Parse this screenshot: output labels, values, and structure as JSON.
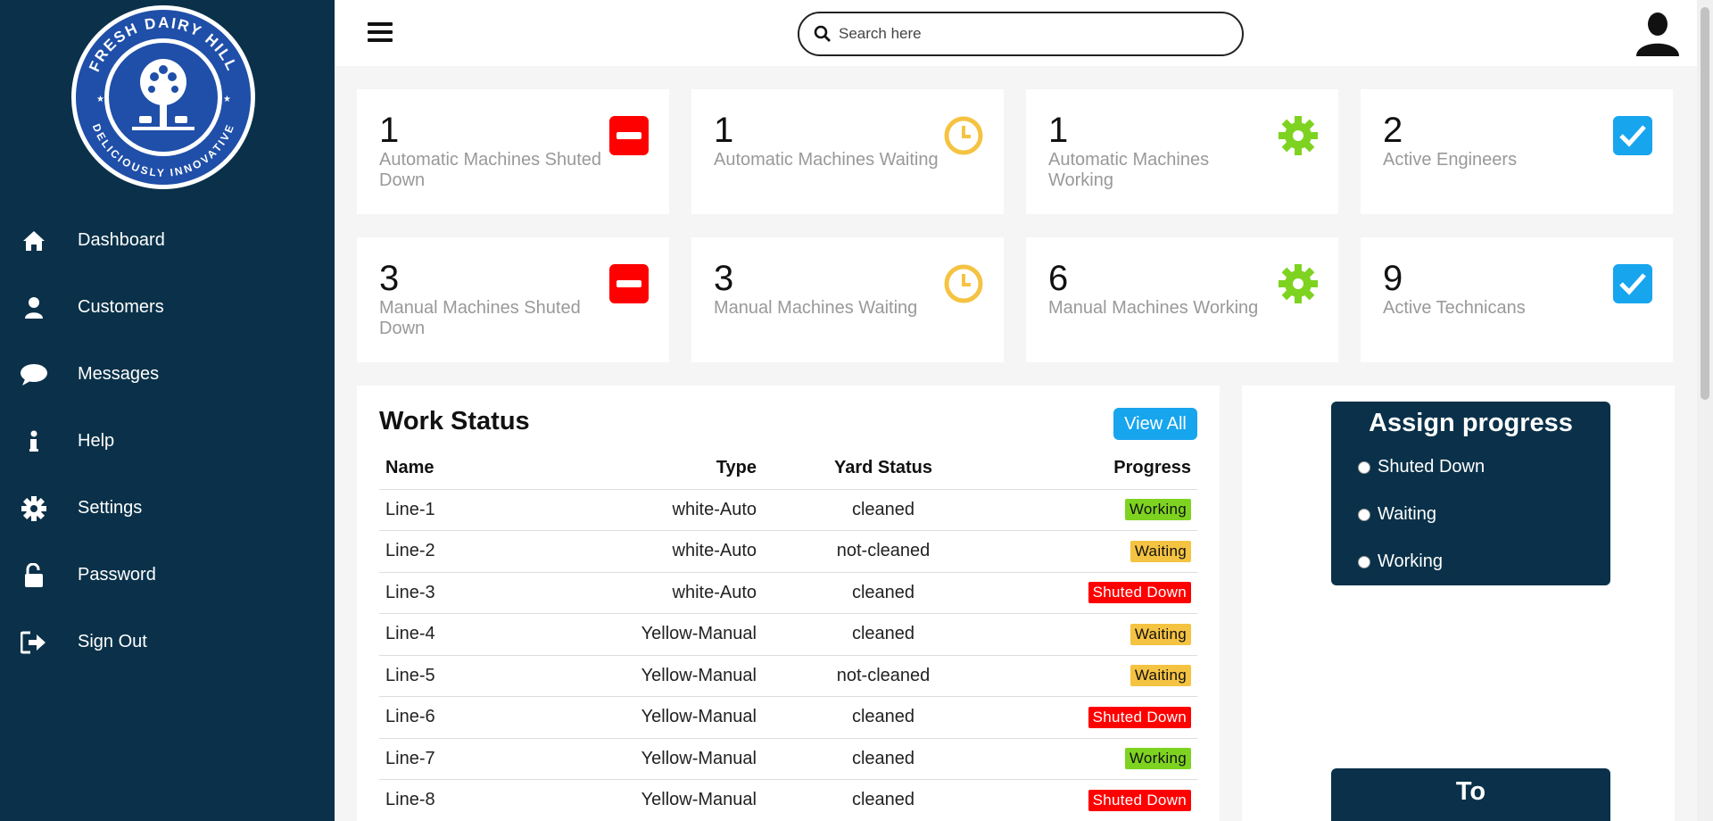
{
  "brand": {
    "logo_top_text": "FRESH DAIRY HILL",
    "logo_bottom_text": "DELICIOUSLY INNOVATIVE"
  },
  "sidebar": {
    "items": [
      {
        "label": "Dashboard",
        "icon": "home-icon"
      },
      {
        "label": "Customers",
        "icon": "user-icon"
      },
      {
        "label": "Messages",
        "icon": "chat-icon"
      },
      {
        "label": "Help",
        "icon": "info-icon"
      },
      {
        "label": "Settings",
        "icon": "gear-icon"
      },
      {
        "label": "Password",
        "icon": "unlock-icon"
      },
      {
        "label": "Sign Out",
        "icon": "sign-out-icon"
      }
    ]
  },
  "topbar": {
    "search_placeholder": "Search here"
  },
  "cards": [
    {
      "number": "1",
      "label": "Automatic Machines Shuted Down",
      "icon": "minus-icon",
      "color": "#ff0000"
    },
    {
      "number": "1",
      "label": "Automatic Machines Waiting",
      "icon": "clock-icon",
      "color": "#f5c342"
    },
    {
      "number": "1",
      "label": "Automatic Machines Working",
      "icon": "gear-icon",
      "color": "#7ed321"
    },
    {
      "number": "2",
      "label": "Active Engineers",
      "icon": "checkbox-icon",
      "color": "#17a5ee"
    },
    {
      "number": "3",
      "label": "Manual Machines Shuted Down",
      "icon": "minus-icon",
      "color": "#ff0000"
    },
    {
      "number": "3",
      "label": "Manual Machines Waiting",
      "icon": "clock-icon",
      "color": "#f5c342"
    },
    {
      "number": "6",
      "label": "Manual Machines Working",
      "icon": "gear-icon",
      "color": "#7ed321"
    },
    {
      "number": "9",
      "label": "Active Technicans",
      "icon": "checkbox-icon",
      "color": "#17a5ee"
    }
  ],
  "work_status": {
    "title": "Work Status",
    "view_all": "View All",
    "headers": {
      "name": "Name",
      "type": "Type",
      "yard": "Yard Status",
      "progress": "Progress"
    },
    "rows": [
      {
        "name": "Line-1",
        "type": "white-Auto",
        "yard": "cleaned",
        "progress": "Working"
      },
      {
        "name": "Line-2",
        "type": "white-Auto",
        "yard": "not-cleaned",
        "progress": "Waiting"
      },
      {
        "name": "Line-3",
        "type": "white-Auto",
        "yard": "cleaned",
        "progress": "Shuted Down"
      },
      {
        "name": "Line-4",
        "type": "Yellow-Manual",
        "yard": "cleaned",
        "progress": "Waiting"
      },
      {
        "name": "Line-5",
        "type": "Yellow-Manual",
        "yard": "not-cleaned",
        "progress": "Waiting"
      },
      {
        "name": "Line-6",
        "type": "Yellow-Manual",
        "yard": "cleaned",
        "progress": "Shuted Down"
      },
      {
        "name": "Line-7",
        "type": "Yellow-Manual",
        "yard": "cleaned",
        "progress": "Working"
      },
      {
        "name": "Line-8",
        "type": "Yellow-Manual",
        "yard": "cleaned",
        "progress": "Shuted Down"
      }
    ]
  },
  "assign_progress": {
    "title": "Assign progress",
    "options": [
      "Shuted Down",
      "Waiting",
      "Working"
    ]
  },
  "to_box": {
    "title": "To"
  },
  "colors": {
    "sidebar_bg": "#0a3149",
    "working": "#7ed321",
    "waiting": "#f5c342",
    "shuted_down": "#ff0000",
    "accent": "#17a5ee"
  }
}
